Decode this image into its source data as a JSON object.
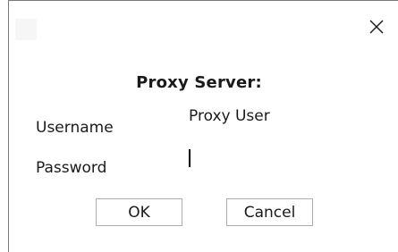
{
  "dialog": {
    "title": "Proxy Server:",
    "close_icon": "close-icon",
    "app_icon": "app-icon"
  },
  "form": {
    "username_label": "Username",
    "username_value": "Proxy User",
    "password_label": "Password",
    "password_value": ""
  },
  "buttons": {
    "ok_label": "OK",
    "cancel_label": "Cancel"
  }
}
